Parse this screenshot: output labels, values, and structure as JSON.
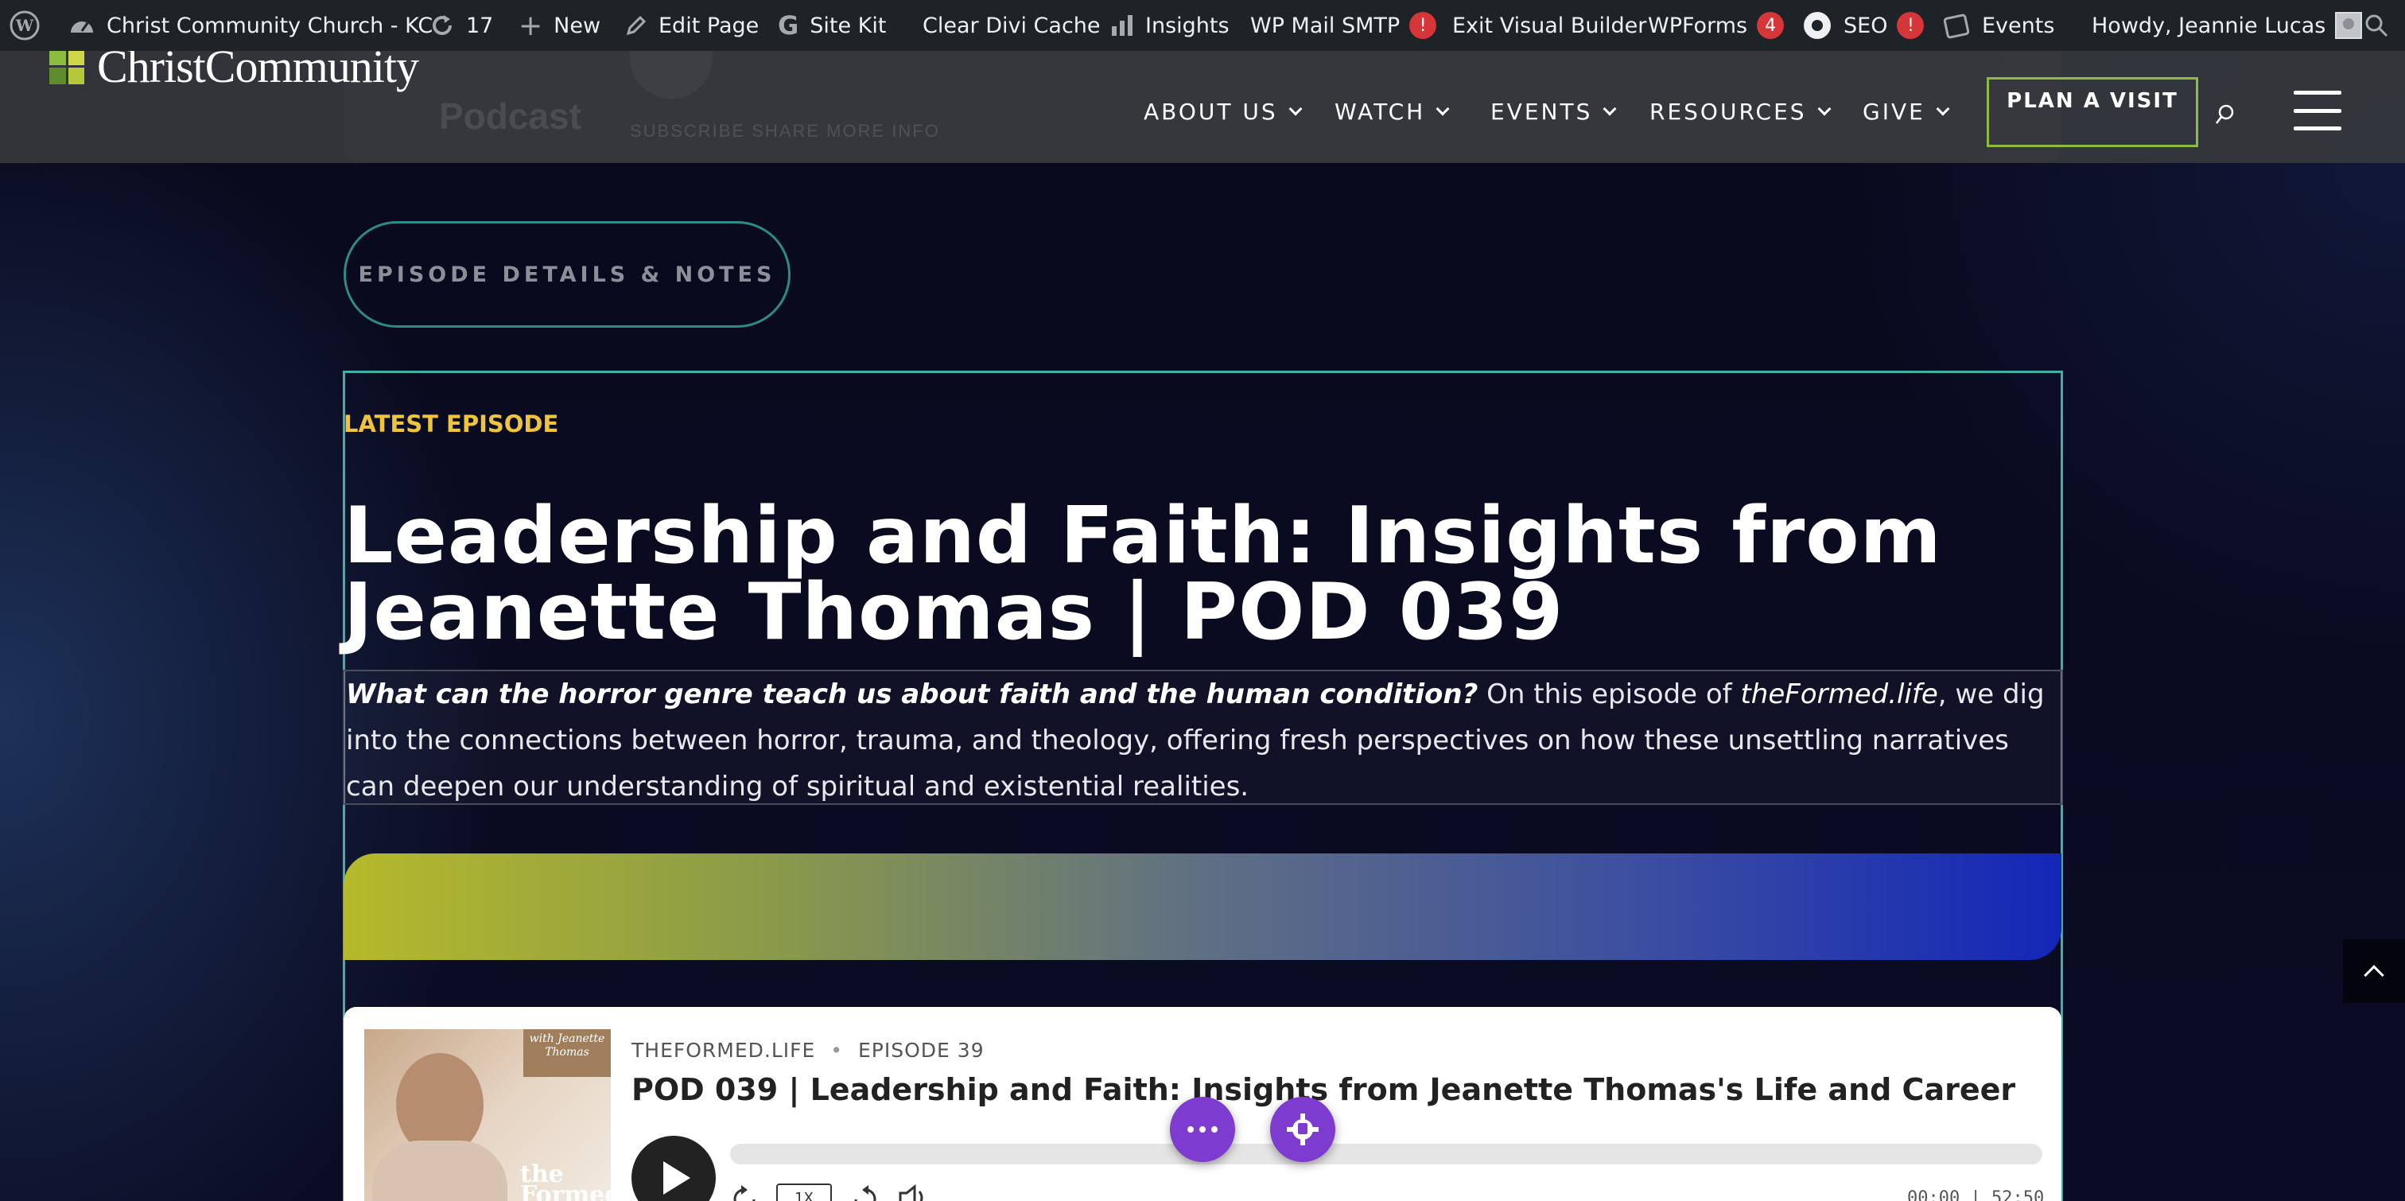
{
  "adminbar": {
    "site_name": "Christ Community Church - KC",
    "updates_count": "17",
    "new_label": "New",
    "edit_page_label": "Edit Page",
    "sitekit_label": "Site Kit",
    "clear_cache_label": "Clear Divi Cache",
    "insights_label": "Insights",
    "wpmail_label": "WP Mail SMTP",
    "wpmail_badge": "!",
    "exit_vb_label": "Exit Visual Builder",
    "wpforms_label": "WPForms",
    "wpforms_badge": "4",
    "seo_label": "SEO",
    "seo_badge": "!",
    "events_label": "Events",
    "howdy_label": "Howdy, Jeannie Lucas"
  },
  "header": {
    "logo_text": "ChristCommunity",
    "logo_colors": [
      "#8cbc3f",
      "#cfd64a",
      "#5f8c2c",
      "#b4c83a"
    ],
    "nav": [
      {
        "label": "ABOUT US"
      },
      {
        "label": "WATCH"
      },
      {
        "label": "EVENTS"
      },
      {
        "label": "RESOURCES"
      },
      {
        "label": "GIVE"
      }
    ],
    "cta_label": "PLAN A VISIT",
    "cta_color": "#8cbc3f"
  },
  "ghost": {
    "podcast_label": "Podcast",
    "links": "SUBSCRIBE   SHARE   MORE INFO"
  },
  "content": {
    "details_button": "EPISODE DETAILS & NOTES",
    "eyebrow": "LATEST EPISODE",
    "eyebrow_color": "#f0c43a",
    "title_line1": "Leadership and Faith: Insights from",
    "title_line2": "Jeanette Thomas | POD 039",
    "intro_question": "What can the horror genre teach us about faith and the human condition?",
    "intro_part1": " On this episode of ",
    "intro_show": "theFormed.life",
    "intro_part2": ", we dig into the connections between horror, trauma, and theology, offering fresh perspectives on how these unsettling narratives can deepen our understanding of spiritual and existential realities."
  },
  "player": {
    "show_name": "THEFORMED.LIFE",
    "separator": "•",
    "episode_label": "EPISODE 39",
    "episode_title": "POD 039 | Leadership and Faith: Insights from Jeanette Thomas's Life and Career",
    "cover_tag": "with Jeanette Thomas",
    "cover_brand": "the Formed life",
    "speed": "1X",
    "time": "00:00 | 52:50",
    "progress": 0
  },
  "divi": {
    "accent": "#7e3bd0"
  }
}
